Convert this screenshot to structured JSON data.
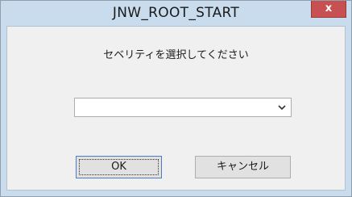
{
  "window": {
    "title": "JNW_ROOT_START",
    "close_glyph": "x"
  },
  "dialog": {
    "prompt": "セベリティを選択してください",
    "severity_select": {
      "value": "",
      "options": []
    },
    "ok_label": "OK",
    "cancel_label": "キャンセル"
  },
  "colors": {
    "frame": "#c9dcee",
    "close": "#c75050",
    "client": "#f0f0f0",
    "button": "#e1e1e1"
  },
  "icons": {
    "close": "close-icon",
    "dropdown": "chevron-down-icon"
  }
}
